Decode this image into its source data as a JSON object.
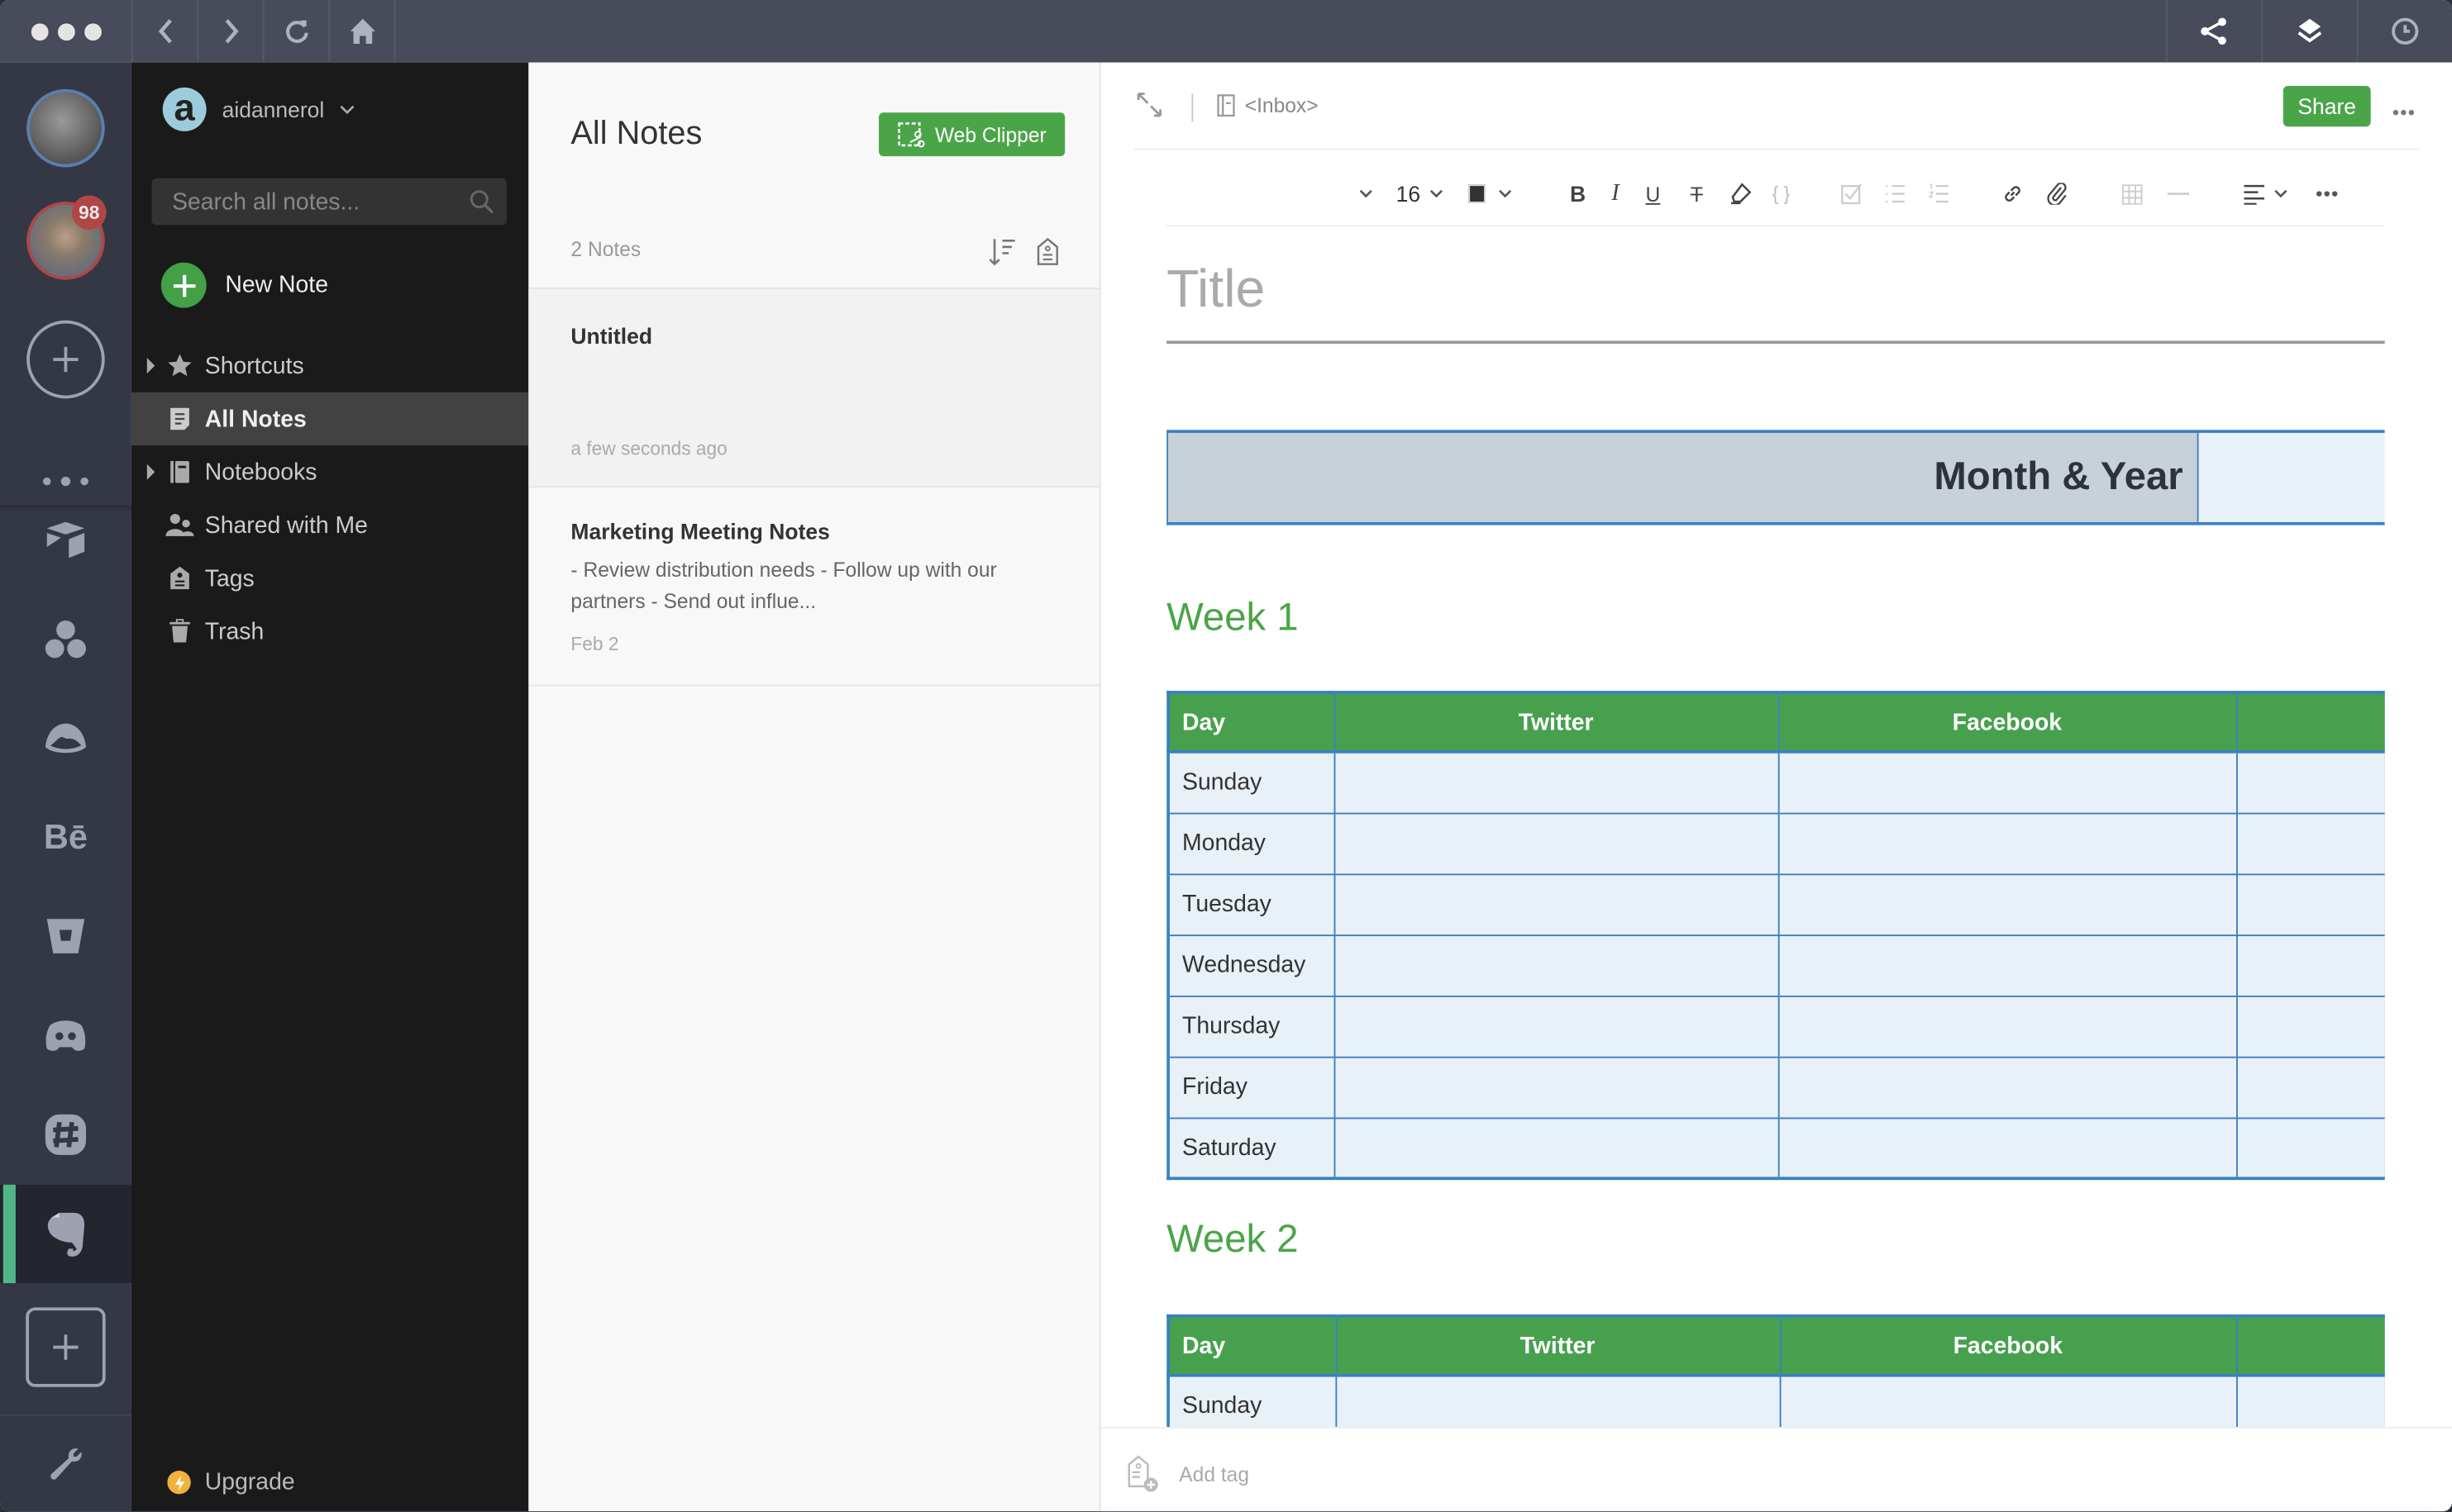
{
  "titlebar": {
    "left_icons": [
      "back-icon",
      "forward-icon",
      "reload-icon",
      "home-icon"
    ],
    "right_icons": [
      "share-icon",
      "layers-icon",
      "clock-icon"
    ]
  },
  "rail": {
    "accounts": [
      {
        "name": "account-avatar-1",
        "ring_color": "#5a7fb0",
        "badge": null
      },
      {
        "name": "account-avatar-2",
        "ring_color": "#b04646",
        "badge": "98"
      }
    ],
    "apps": [
      {
        "icon": "airtable-icon"
      },
      {
        "icon": "asana-icon"
      },
      {
        "icon": "basecamp-icon"
      },
      {
        "icon": "behance-icon",
        "glyph": "Bē"
      },
      {
        "icon": "bitbucket-icon"
      },
      {
        "icon": "discord-icon"
      },
      {
        "icon": "slack-icon"
      },
      {
        "icon": "evernote-icon",
        "active": true
      }
    ],
    "active_color": "#52b788"
  },
  "sidebar": {
    "account_logo": "a",
    "account_name": "aidannerol",
    "search_placeholder": "Search all notes...",
    "new_note_label": "New Note",
    "nav": [
      {
        "label": "Shortcuts",
        "icon": "star-icon",
        "expandable": true,
        "active": false
      },
      {
        "label": "All Notes",
        "icon": "note-icon",
        "expandable": false,
        "active": true
      },
      {
        "label": "Notebooks",
        "icon": "notebook-icon",
        "expandable": true,
        "active": false
      },
      {
        "label": "Shared with Me",
        "icon": "people-icon",
        "expandable": false,
        "active": false
      },
      {
        "label": "Tags",
        "icon": "tag-icon",
        "expandable": false,
        "active": false
      },
      {
        "label": "Trash",
        "icon": "trash-icon",
        "expandable": false,
        "active": false
      }
    ],
    "upgrade_label": "Upgrade"
  },
  "notelist": {
    "title": "All Notes",
    "web_clipper_label": "Web Clipper",
    "count": "2 Notes",
    "notes": [
      {
        "title": "Untitled",
        "snippet": "",
        "date": "a few seconds ago",
        "selected": true
      },
      {
        "title": "Marketing Meeting Notes",
        "snippet": "- Review distribution needs - Follow up with our partners - Send out influe...",
        "date": "Feb 2",
        "selected": false
      }
    ]
  },
  "editor": {
    "notebook": "<Inbox>",
    "share_label": "Share",
    "toolbar": {
      "font_size": "16",
      "font_color": "#333333"
    },
    "title_placeholder": "Title",
    "month_header": "Month & Year",
    "weeks": [
      {
        "heading": "Week 1",
        "columns": [
          "Day",
          "Twitter",
          "Facebook",
          ""
        ],
        "rows": [
          "Sunday",
          "Monday",
          "Tuesday",
          "Wednesday",
          "Thursday",
          "Friday",
          "Saturday"
        ]
      },
      {
        "heading": "Week 2",
        "columns": [
          "Day",
          "Twitter",
          "Facebook",
          ""
        ],
        "rows": [
          "Sunday"
        ]
      }
    ],
    "add_tag_label": "Add tag"
  },
  "colors": {
    "brand_green": "#4aa548",
    "table_border": "#3a80c0",
    "table_header": "#47a04e",
    "cell_fill": "#e9f1f8"
  }
}
